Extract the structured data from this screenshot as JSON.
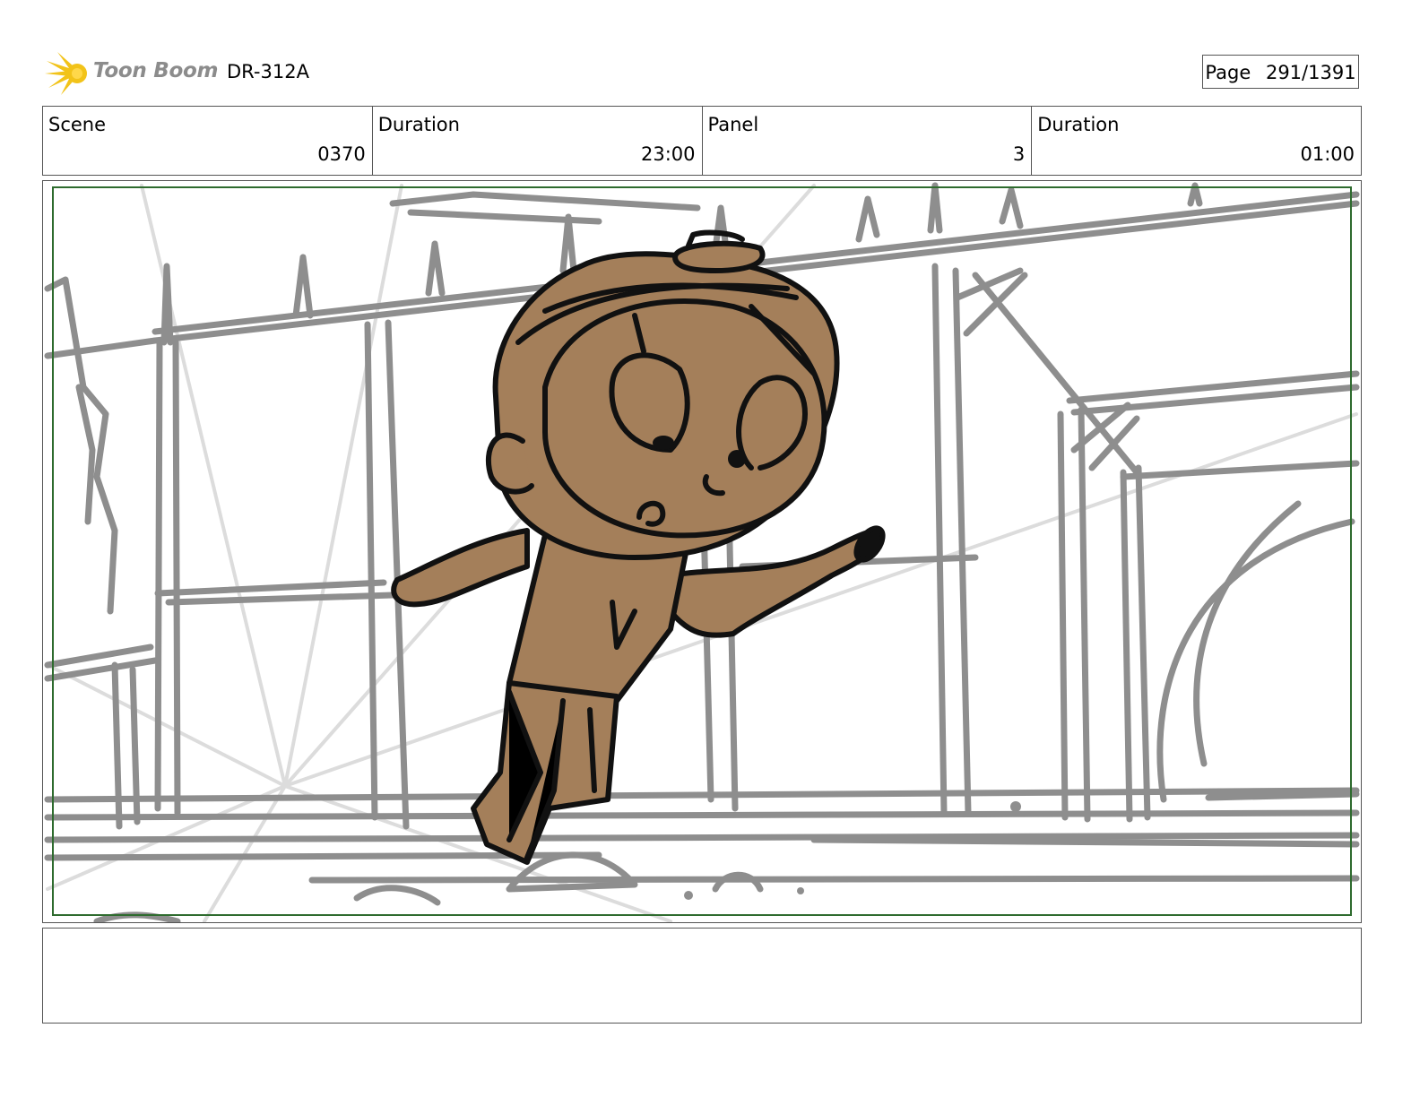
{
  "header": {
    "brand": "Toon Boom",
    "doc_id": "DR-312A",
    "page_label": "Page",
    "page_number": "291/1391"
  },
  "info": {
    "scene_label": "Scene",
    "scene_value": "0370",
    "scene_duration_label": "Duration",
    "scene_duration_value": "23:00",
    "panel_label": "Panel",
    "panel_value": "3",
    "panel_duration_label": "Duration",
    "panel_duration_value": "01:00"
  },
  "panel": {
    "safe_frame_color": "#2e6b2e",
    "sketch_color": "#8e8e8e",
    "character_fill": "#a47f5a",
    "ink_color": "#111111"
  },
  "notes": {
    "text": ""
  }
}
